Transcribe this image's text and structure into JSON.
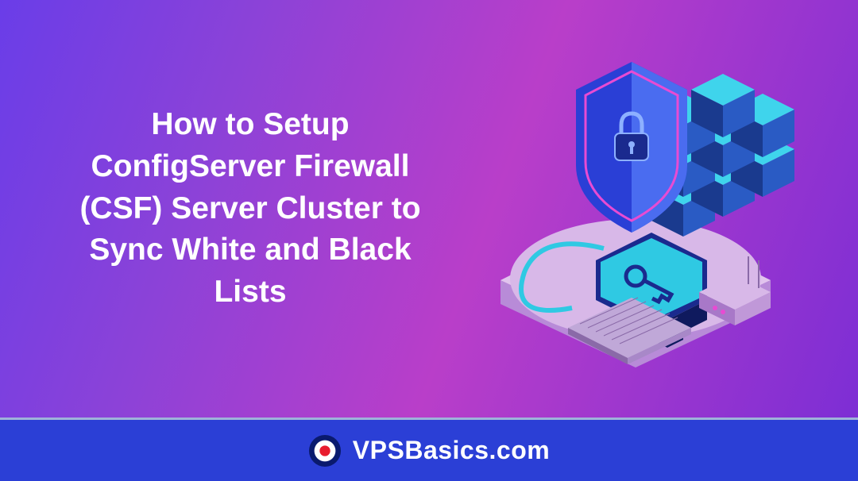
{
  "hero": {
    "title": "How to Setup ConfigServer Firewall (CSF) Server Cluster to Sync White and Black Lists"
  },
  "footer": {
    "brand": "VPSBasics.com"
  },
  "icons": {
    "shield": "shield-lock-icon",
    "logo": "roundel-logo-icon",
    "computer": "computer-icon",
    "blocks": "server-blocks-icon"
  },
  "colors": {
    "bg_gradient_start": "#6a3de8",
    "bg_gradient_end": "#b93ec9",
    "footer_bg": "#2b3fd6",
    "accent_pink": "#e84bd3",
    "accent_cyan": "#2fc9e3",
    "platform": "#d8b8e8"
  }
}
